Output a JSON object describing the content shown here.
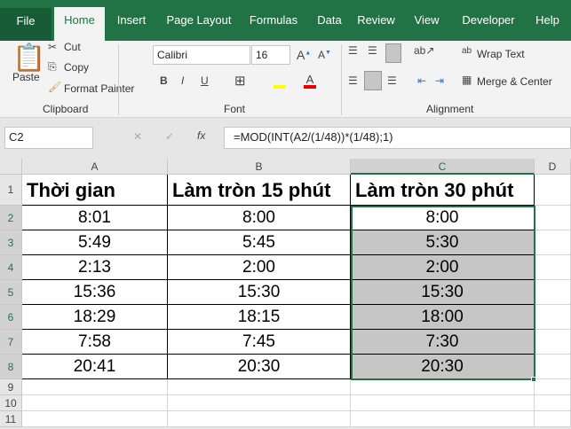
{
  "tabs": [
    "File",
    "Home",
    "Insert",
    "Page Layout",
    "Formulas",
    "Data",
    "Review",
    "View",
    "Developer",
    "Help"
  ],
  "clipboard": {
    "paste": "Paste",
    "cut": "Cut",
    "copy": "Copy",
    "format_painter": "Format Painter",
    "group": "Clipboard"
  },
  "font": {
    "name": "Calibri",
    "size": "16",
    "bold": "B",
    "italic": "I",
    "underline": "U",
    "group": "Font"
  },
  "alignment": {
    "wrap": "Wrap Text",
    "merge": "Merge & Center",
    "group": "Alignment"
  },
  "formula_bar": {
    "name_box": "C2",
    "fx": "fx",
    "formula": "=MOD(INT(A2/(1/48))*(1/48);1)"
  },
  "columns": [
    "A",
    "B",
    "C",
    "D"
  ],
  "row_numbers": [
    "1",
    "2",
    "3",
    "4",
    "5",
    "6",
    "7",
    "8",
    "9",
    "10",
    "11"
  ],
  "headers": [
    "Thời gian",
    "Làm tròn 15 phút",
    "Làm tròn 30 phút"
  ],
  "rows": [
    [
      "8:01",
      "8:00",
      "8:00"
    ],
    [
      "5:49",
      "5:45",
      "5:30"
    ],
    [
      "2:13",
      "2:00",
      "2:00"
    ],
    [
      "15:36",
      "15:30",
      "15:30"
    ],
    [
      "18:29",
      "18:15",
      "18:00"
    ],
    [
      "7:58",
      "7:45",
      "7:30"
    ],
    [
      "20:41",
      "20:30",
      "20:30"
    ]
  ],
  "colors": {
    "accent": "#217346",
    "selection": "#c6c6c6"
  }
}
